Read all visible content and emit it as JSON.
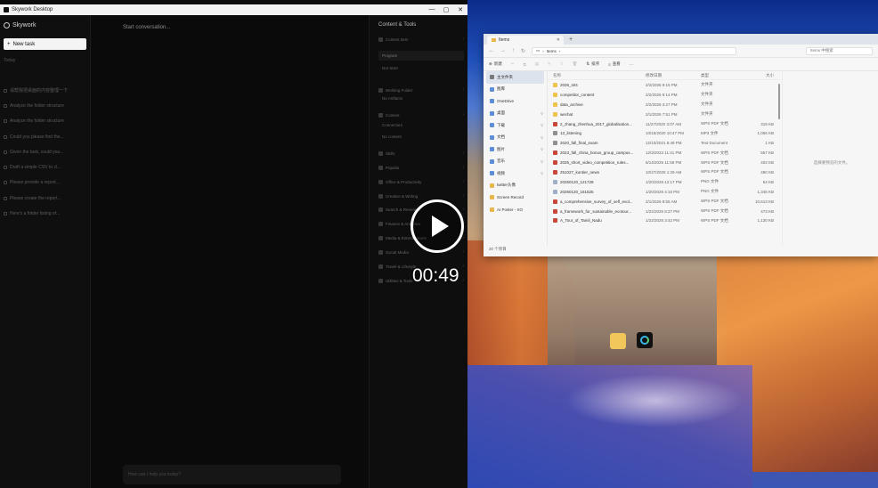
{
  "app": {
    "window_title": "Skywork Desktop",
    "window_buttons": [
      "—",
      "▢",
      "✕"
    ],
    "brand": "Skywork",
    "new_task": "New task",
    "history_label": "Today",
    "history": [
      "请帮我把桌面的内容整理一下",
      "Analyze the folder structure",
      "Analyze the folder structure",
      "Could you please find the...",
      "Given the task, could you...",
      "Draft a simple CSV to cl...",
      "Please provide a report...",
      "Please create the report...",
      "Here's a folder listing of..."
    ],
    "chat_title": "Start conversation...",
    "chat_placeholder": "How can I help you today?",
    "tools": {
      "title": "Content & Tools",
      "rows": [
        {
          "label": "Context Item",
          "style": "item"
        },
        {
          "label": "Program",
          "style": "hi"
        },
        {
          "label": "Not Start",
          "style": "sub"
        },
        {
          "label": "Working Folder",
          "style": "item"
        },
        {
          "label": "No Artifacts",
          "style": "sub"
        },
        {
          "label": "Context",
          "style": "item"
        },
        {
          "label": "Connectors",
          "style": "sub"
        },
        {
          "label": "No content",
          "style": "sub"
        },
        {
          "label": "Skills",
          "style": "item"
        },
        {
          "label": "Popular",
          "style": "cat"
        },
        {
          "label": "Office & Productivity",
          "style": "cat"
        },
        {
          "label": "Creative & Writing",
          "style": "cat"
        },
        {
          "label": "Search & Research",
          "style": "cat"
        },
        {
          "label": "Finance & Analytics",
          "style": "cat"
        },
        {
          "label": "Media & Entertainment",
          "style": "cat"
        },
        {
          "label": "Social Media",
          "style": "cat"
        },
        {
          "label": "Travel & Lifestyle",
          "style": "cat"
        },
        {
          "label": "Utilities & Tools",
          "style": "cat"
        }
      ]
    }
  },
  "explorer": {
    "tab_title": "Items",
    "breadcrumb": "Items",
    "search_placeholder": "Items 中搜索",
    "toolbar": [
      "新建",
      "排序",
      "查看",
      "···"
    ],
    "nav": [
      {
        "label": "主文件夹",
        "kind": "home",
        "selected": true
      },
      {
        "label": "图库",
        "kind": "gallery"
      },
      {
        "label": "OneDrive",
        "kind": "cloud"
      },
      {
        "label": "桌面",
        "kind": "folder"
      },
      {
        "label": "下载",
        "kind": "folder"
      },
      {
        "label": "文档",
        "kind": "folder"
      },
      {
        "label": "图片",
        "kind": "folder"
      },
      {
        "label": "音乐",
        "kind": "folder"
      },
      {
        "label": "视频",
        "kind": "folder"
      },
      {
        "label": "twitter头像",
        "kind": "yellow"
      },
      {
        "label": "Screen Record",
        "kind": "yellow"
      },
      {
        "label": "AI Poster - XO",
        "kind": "yellow"
      }
    ],
    "columns": [
      "名称",
      "修改日期",
      "类型",
      "大小"
    ],
    "files": [
      {
        "name": "2026_s04",
        "date": "2/2/2026 9:15 PM",
        "type": "文件夹",
        "size": "",
        "icon": "folder"
      },
      {
        "name": "competitor_content",
        "date": "2/2/2026 9:14 PM",
        "type": "文件夹",
        "size": "",
        "icon": "folder"
      },
      {
        "name": "data_archive",
        "date": "2/2/2026 3:27 PM",
        "type": "文件夹",
        "size": "",
        "icon": "folder"
      },
      {
        "name": "wechat",
        "date": "2/1/2026 7:51 PM",
        "type": "文件夹",
        "size": "",
        "icon": "folder"
      },
      {
        "name": "2_zhang_zhenhua_2017_globalisation...",
        "date": "11/27/2020 3:07 AM",
        "type": "WPS PDF 文档",
        "size": "318 KB",
        "icon": "pdf"
      },
      {
        "name": "13_listening",
        "date": "10/15/2020 10:47 PM",
        "type": "MP3 文件",
        "size": "1,056 KB",
        "icon": "doc"
      },
      {
        "name": "2020_fall_final_exam",
        "date": "12/10/2021 8:49 PM",
        "type": "Text Document",
        "size": "1 KB",
        "icon": "doc"
      },
      {
        "name": "2023_fall_china_bonus_group_campus...",
        "date": "12/3/2023 11:41 PM",
        "type": "WPS PDF 文档",
        "size": "557 KB",
        "icon": "pdf"
      },
      {
        "name": "2025_short_video_competition_rules...",
        "date": "5/14/2025 11:58 PM",
        "type": "WPS PDF 文档",
        "size": "402 KB",
        "icon": "pdf"
      },
      {
        "name": "251027_kontier_news",
        "date": "10/27/2025 1:29 AM",
        "type": "WPS PDF 文档",
        "size": "490 KB",
        "icon": "pdf"
      },
      {
        "name": "20260120_121728",
        "date": "1/20/2026 12:17 PM",
        "type": "PNG 文件",
        "size": "64 KB",
        "icon": "img"
      },
      {
        "name": "20260120_161525",
        "date": "1/20/2026 4:15 PM",
        "type": "PNG 文件",
        "size": "1,345 KB",
        "icon": "img"
      },
      {
        "name": "a_comprehensive_survey_of_self_evol...",
        "date": "2/1/2026 8:55 AM",
        "type": "WPS PDF 文档",
        "size": "10,613 KB",
        "icon": "pdf"
      },
      {
        "name": "a_framework_for_sustainable_ecotour...",
        "date": "1/22/2026 8:27 PM",
        "type": "WPS PDF 文档",
        "size": "473 KB",
        "icon": "pdf"
      },
      {
        "name": "A_Tour_of_Tamil_Nadu",
        "date": "1/22/2026 3:42 PM",
        "type": "WPS PDF 文档",
        "size": "1,130 KB",
        "icon": "pdf"
      }
    ],
    "preview_message": "选择要预览的文件。",
    "status": "30 个项目"
  },
  "desktop": {
    "icons": [
      "folder-shortcut",
      "skywork-app"
    ]
  },
  "video": {
    "timecode": "00:49"
  }
}
